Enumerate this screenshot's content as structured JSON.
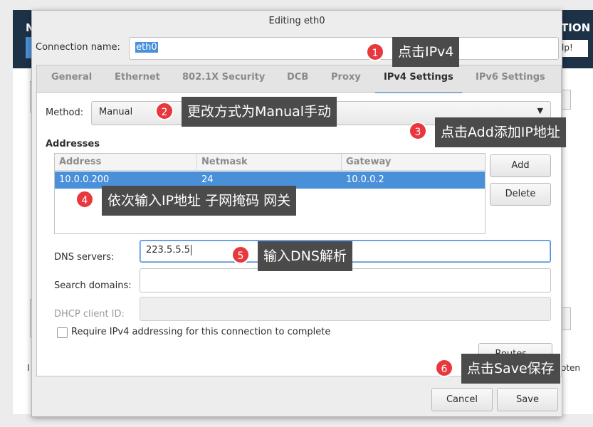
{
  "background": {
    "left_fragment": "N",
    "right_fragment": "TION",
    "help_fragment": "lp!",
    "bottom_left_fragment": "I",
    "bottom_right_fragment": "oten"
  },
  "dialog": {
    "title": "Editing eth0",
    "connection_name_label": "Connection name:",
    "connection_name_value": "eth0",
    "tabs": [
      {
        "label": "General"
      },
      {
        "label": "Ethernet"
      },
      {
        "label": "802.1X Security"
      },
      {
        "label": "DCB"
      },
      {
        "label": "Proxy"
      },
      {
        "label": "IPv4 Settings"
      },
      {
        "label": "IPv6 Settings"
      }
    ],
    "active_tab": "IPv4 Settings",
    "method_label": "Method:",
    "method_value": "Manual",
    "addresses_heading": "Addresses",
    "address_columns": [
      "Address",
      "Netmask",
      "Gateway"
    ],
    "address_rows": [
      {
        "address": "10.0.0.200",
        "netmask": "24",
        "gateway": "10.0.0.2"
      }
    ],
    "add_label": "Add",
    "delete_label": "Delete",
    "dns_label": "DNS servers:",
    "dns_value": "223.5.5.5",
    "search_label": "Search domains:",
    "search_value": "",
    "dhcp_label": "DHCP client ID:",
    "dhcp_value": "",
    "require_label": "Require IPv4 addressing for this connection to complete",
    "require_checked": false,
    "routes_label": "Routes...",
    "cancel_label": "Cancel",
    "save_label": "Save"
  },
  "annotations": [
    {
      "number": "1",
      "text": "点击IPv4"
    },
    {
      "number": "2",
      "text": "更改方式为Manual手动"
    },
    {
      "number": "3",
      "text": "点击Add添加IP地址"
    },
    {
      "number": "4",
      "text": "依次输入IP地址 子网掩码 网关"
    },
    {
      "number": "5",
      "text": "输入DNS解析"
    },
    {
      "number": "6",
      "text": "点击Save保存"
    }
  ],
  "colors": {
    "accent": "#4a90d9",
    "badge": "#e8383d",
    "tooltip": "#4b4b4b",
    "installer_header": "#1d3147"
  }
}
